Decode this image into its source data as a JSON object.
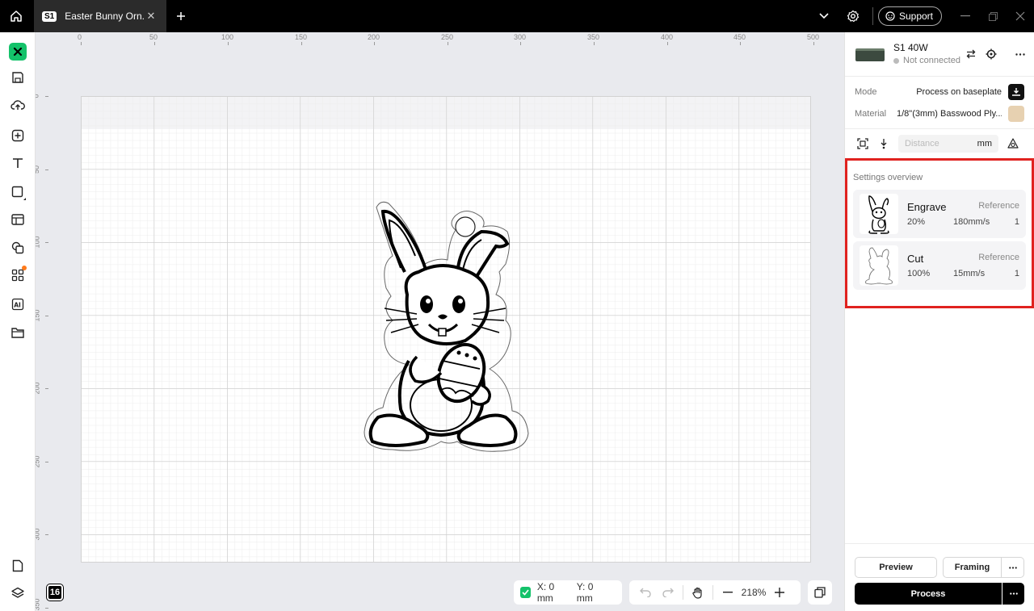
{
  "titlebar": {
    "tab_badge": "S1",
    "tab_title": "Easter Bunny Orn...",
    "support_label": "Support"
  },
  "canvas": {
    "ruler_top": [
      "0",
      "50",
      "100",
      "150",
      "200",
      "250",
      "300",
      "350",
      "400",
      "450",
      "500"
    ],
    "ruler_left": [
      "0",
      "50",
      "100",
      "150",
      "200",
      "250",
      "300",
      "350"
    ],
    "layer_count": "16",
    "coords": {
      "x": "X: 0 mm",
      "y": "Y: 0 mm"
    },
    "zoom": "218%"
  },
  "device": {
    "name": "S1 40W",
    "status": "Not connected"
  },
  "settings": {
    "mode_label": "Mode",
    "mode_value": "Process on baseplate",
    "material_label": "Material",
    "material_value": "1/8\"(3mm) Basswood Ply...",
    "material_color": "#e7d1b1",
    "distance_placeholder": "Distance",
    "distance_unit": "mm"
  },
  "overview": {
    "title": "Settings overview",
    "items": [
      {
        "name": "Engrave",
        "ref": "Reference",
        "power": "20%",
        "speed": "180mm/s",
        "passes": "1"
      },
      {
        "name": "Cut",
        "ref": "Reference",
        "power": "100%",
        "speed": "15mm/s",
        "passes": "1"
      }
    ]
  },
  "actions": {
    "preview": "Preview",
    "framing": "Framing",
    "process": "Process"
  },
  "colors": {
    "accent": "#14c26a",
    "highlight": "#e0221f",
    "notification": "#ff7a1a"
  }
}
